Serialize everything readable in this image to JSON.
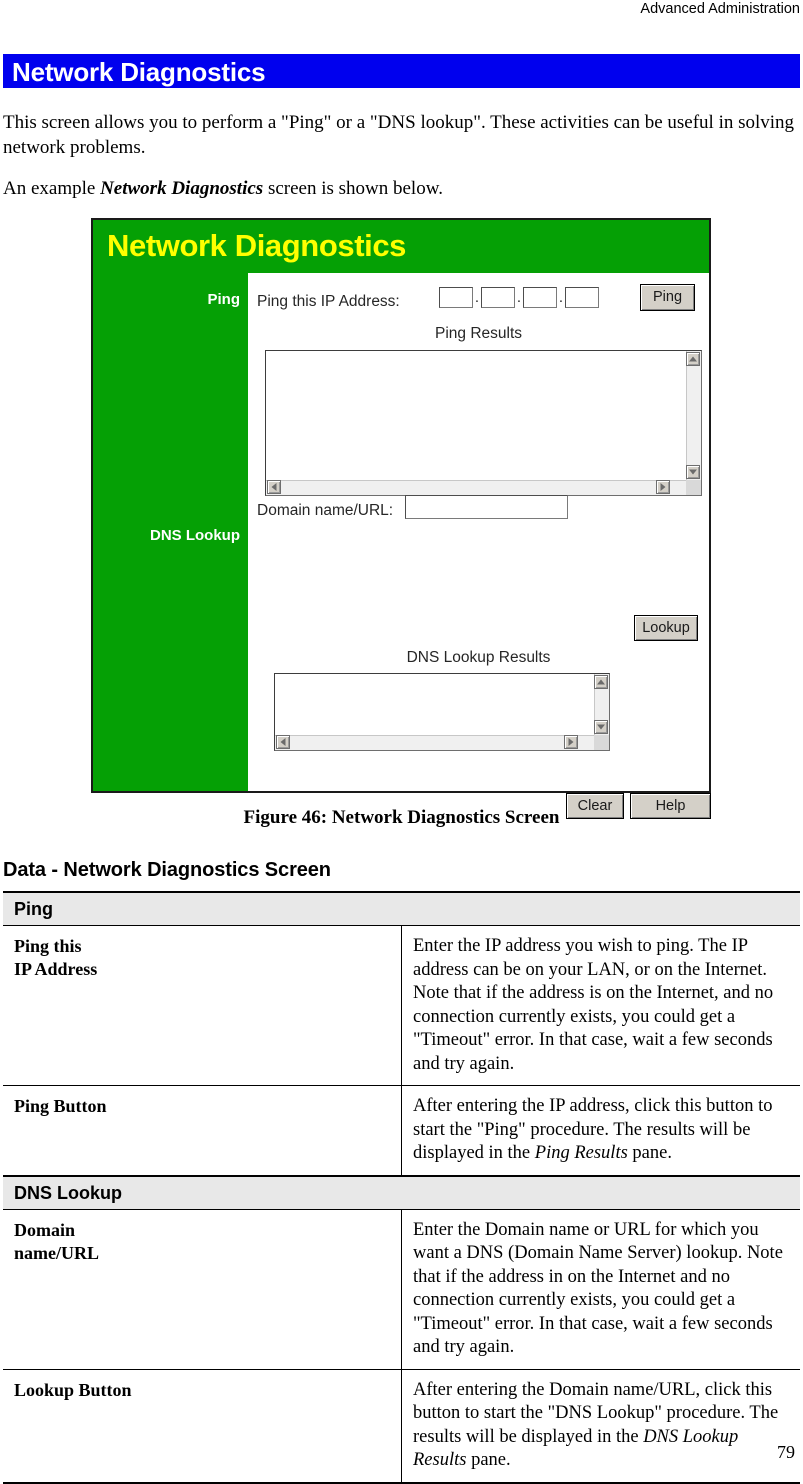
{
  "running_head": "Advanced Administration",
  "banner": {
    "title": "Network Diagnostics",
    "color": "#0000EE"
  },
  "paragraphs": {
    "intro": "This screen allows you to perform a \"Ping\" or a \"DNS lookup\". These activities can be useful in solving network problems.",
    "example_prefix": "An example ",
    "example_italic": "Network Diagnostics",
    "example_suffix": " screen is shown below."
  },
  "figure": {
    "caption": "Figure 46: Network Diagnostics Screen",
    "header_title": "Network Diagnostics",
    "header_bg": "#05A005",
    "header_fg": "#FFFF00",
    "sidebar": {
      "ping_label": "Ping",
      "dns_label": "DNS Lookup"
    },
    "ping": {
      "field_label": "Ping this IP Address:",
      "octets": [
        "",
        "",
        "",
        ""
      ],
      "separator": ".",
      "button": "Ping",
      "results_label": "Ping Results",
      "results_value": ""
    },
    "dns": {
      "field_label": "Domain name/URL:",
      "input_value": "",
      "button": "Lookup",
      "results_label": "DNS Lookup Results",
      "results_value": ""
    },
    "footer_buttons": {
      "clear": "Clear",
      "help": "Help"
    }
  },
  "data_section": {
    "heading": "Data - Network Diagnostics Screen",
    "groups": [
      {
        "title": "Ping",
        "rows": [
          {
            "label": "Ping this\nIP Address",
            "desc_parts": [
              {
                "text": "Enter the IP address you wish to ping. The IP address can be on your LAN, or on the Internet. Note that if the address is on the Internet, and no connection currently exists, you could get a \"Timeout\" error. In that case, wait a few seconds and try again.",
                "italic": false
              }
            ]
          },
          {
            "label": "Ping Button",
            "desc_parts": [
              {
                "text": "After entering the IP address, click this button to start the \"Ping\" procedure. The results will be displayed in the ",
                "italic": false
              },
              {
                "text": "Ping Results",
                "italic": true
              },
              {
                "text": " pane.",
                "italic": false
              }
            ]
          }
        ]
      },
      {
        "title": "DNS Lookup",
        "rows": [
          {
            "label": "Domain\nname/URL",
            "desc_parts": [
              {
                "text": "Enter the Domain name or URL for which you want a DNS (Domain Name Server) lookup. Note that if the address in on the Internet and no connection currently exists, you could get a \"Timeout\" error. In that case, wait a few seconds and try again.",
                "italic": false
              }
            ]
          },
          {
            "label": "Lookup Button",
            "desc_parts": [
              {
                "text": "After entering the Domain name/URL, click this button to start the \"DNS Lookup\" procedure. The results will be displayed in the ",
                "italic": false
              },
              {
                "text": "DNS Lookup Results",
                "italic": true
              },
              {
                "text": " pane.",
                "italic": false
              }
            ]
          }
        ]
      }
    ]
  },
  "page_number": "79"
}
